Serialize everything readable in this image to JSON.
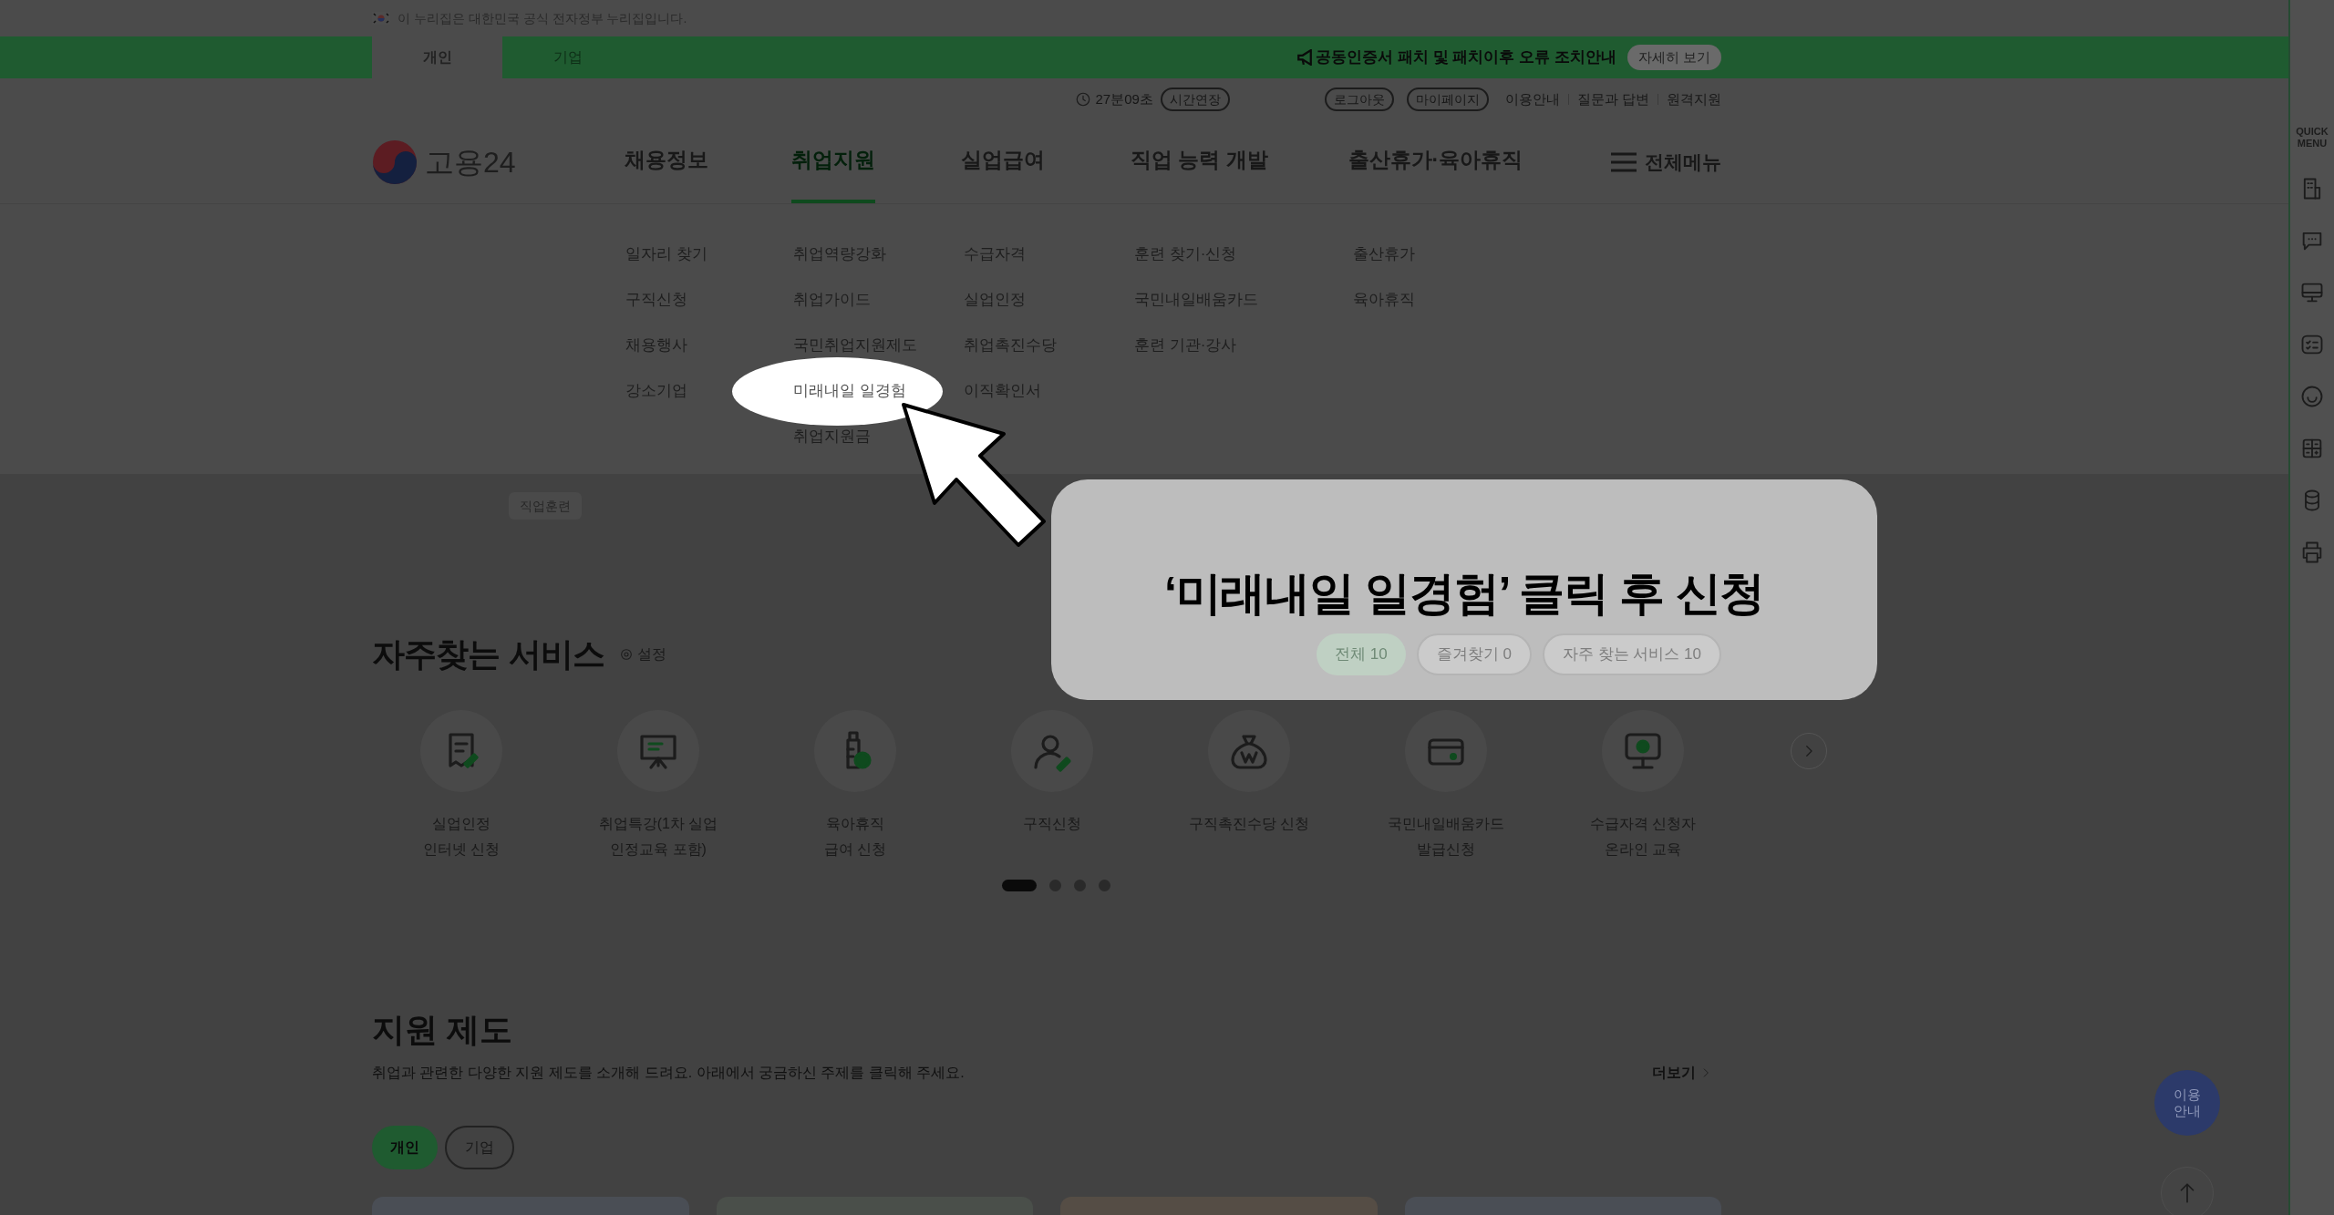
{
  "gov_banner": {
    "text": "이 누리집은 대한민국 공식 전자정부 누리집입니다."
  },
  "user_tabs": [
    {
      "label": "개인",
      "selected": true
    },
    {
      "label": "기업",
      "selected": false
    }
  ],
  "notice": {
    "text": "공동인증서 패치 및 패치이후 오류 조치안내",
    "button": "자세히 보기"
  },
  "utility": {
    "timer": "27분09초",
    "extend": "시간연장",
    "buttons": [
      "로그아웃",
      "마이페이지"
    ],
    "links": [
      "이용안내",
      "질문과 답변",
      "원격지원"
    ]
  },
  "logo": "고용24",
  "nav": [
    {
      "label": "채용정보",
      "selected": false,
      "submenu": [
        {
          "label": "일자리 찾기",
          "highlighted": false
        },
        {
          "label": "구직신청",
          "highlighted": false
        },
        {
          "label": "채용행사",
          "highlighted": false
        },
        {
          "label": "강소기업",
          "highlighted": false
        }
      ]
    },
    {
      "label": "취업지원",
      "selected": true,
      "submenu": [
        {
          "label": "취업역량강화",
          "highlighted": false
        },
        {
          "label": "취업가이드",
          "highlighted": false
        },
        {
          "label": "국민취업지원제도",
          "highlighted": false
        },
        {
          "label": "미래내일 일경험",
          "highlighted": true
        },
        {
          "label": "취업지원금",
          "highlighted": false
        }
      ]
    },
    {
      "label": "실업급여",
      "selected": false,
      "submenu": [
        {
          "label": "수급자격",
          "highlighted": false
        },
        {
          "label": "실업인정",
          "highlighted": false
        },
        {
          "label": "취업촉진수당",
          "highlighted": false
        },
        {
          "label": "이직확인서",
          "highlighted": false
        }
      ]
    },
    {
      "label": "직업 능력 개발",
      "selected": false,
      "submenu": [
        {
          "label": "훈련 찾기·신청",
          "highlighted": false
        },
        {
          "label": "국민내일배움카드",
          "highlighted": false
        },
        {
          "label": "훈련 기관·강사",
          "highlighted": false
        }
      ]
    },
    {
      "label": "출산휴가·육아휴직",
      "selected": false,
      "submenu": [
        {
          "label": "출산휴가",
          "highlighted": false
        },
        {
          "label": "육아휴직",
          "highlighted": false
        }
      ]
    }
  ],
  "full_menu": "전체메뉴",
  "partial_chip": "직업훈련",
  "callout": "‘미래내일 일경험’ 클릭 후 신청",
  "services": {
    "title": "자주찾는 서비스",
    "settings": "설정",
    "filters": [
      {
        "label": "전체 10",
        "selected": true
      },
      {
        "label": "즐겨찾기 0",
        "selected": false
      },
      {
        "label": "자주 찾는 서비스 10",
        "selected": false
      }
    ],
    "items": [
      {
        "label": "실업인정\n인터넷 신청"
      },
      {
        "label": "취업특강(1차 실업\n인정교육 포함)"
      },
      {
        "label": "육아휴직\n급여 신청"
      },
      {
        "label": "구직신청"
      },
      {
        "label": "구직촉진수당 신청"
      },
      {
        "label": "국민내일배움카드\n발급신청"
      },
      {
        "label": "수급자격 신청자\n온라인 교육"
      }
    ],
    "pager": [
      {
        "selected": true
      },
      {
        "selected": false
      },
      {
        "selected": false
      },
      {
        "selected": false
      }
    ]
  },
  "support": {
    "title": "지원 제도",
    "description": "취업과 관련한 다양한 지원 제도를 소개해 드려요. 아래에서 궁금하신 주제를 클릭해 주세요.",
    "more": "더보기",
    "tabs": [
      {
        "label": "개인",
        "selected": true
      },
      {
        "label": "기업",
        "selected": false
      }
    ]
  },
  "quick_menu": {
    "title": "QUICK\nMENU"
  },
  "guide_button": "이용\n안내"
}
